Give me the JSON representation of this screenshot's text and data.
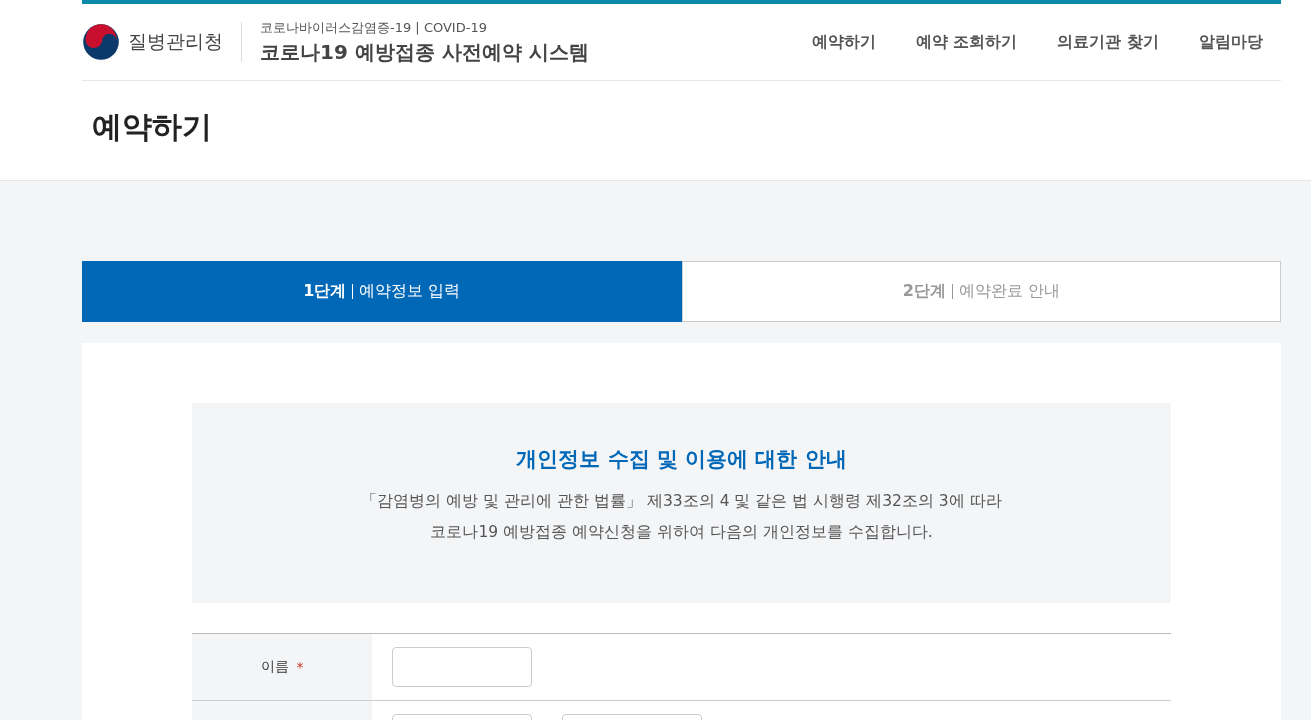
{
  "header": {
    "agency": "질병관리청",
    "subtitle": "코로나바이러스감염증-19 | COVID-19",
    "title": "코로나19 예방접종 사전예약 시스템"
  },
  "nav": [
    {
      "label": "예약하기",
      "selected": false
    },
    {
      "label": "예약 조회하기",
      "selected": false
    },
    {
      "label": "의료기관 찾기",
      "selected": false
    },
    {
      "label": "알림마당",
      "selected": false
    }
  ],
  "page_title": "예약하기",
  "steps": [
    {
      "step": "1단계",
      "label": "예약정보 입력",
      "selected": true
    },
    {
      "step": "2단계",
      "label": "예약완료 안내",
      "selected": false
    }
  ],
  "notice": {
    "title": "개인정보 수집 및 이용에 대한 안내",
    "lines": [
      "「감염병의 예방 및 관리에 관한 법률」 제33조의 4 및 같은 법 시행령 제32조의 3에 따라",
      "코로나19 예방접종 예약신청을 위하여 다음의 개인정보를 수집합니다."
    ]
  },
  "form_rows": [
    {
      "label": "이름",
      "required_mark": "*",
      "inputs": [
        {
          "kind": "text"
        }
      ]
    },
    {
      "inputs": [
        {
          "kind": "text"
        },
        {
          "kind": "text"
        }
      ]
    }
  ]
}
